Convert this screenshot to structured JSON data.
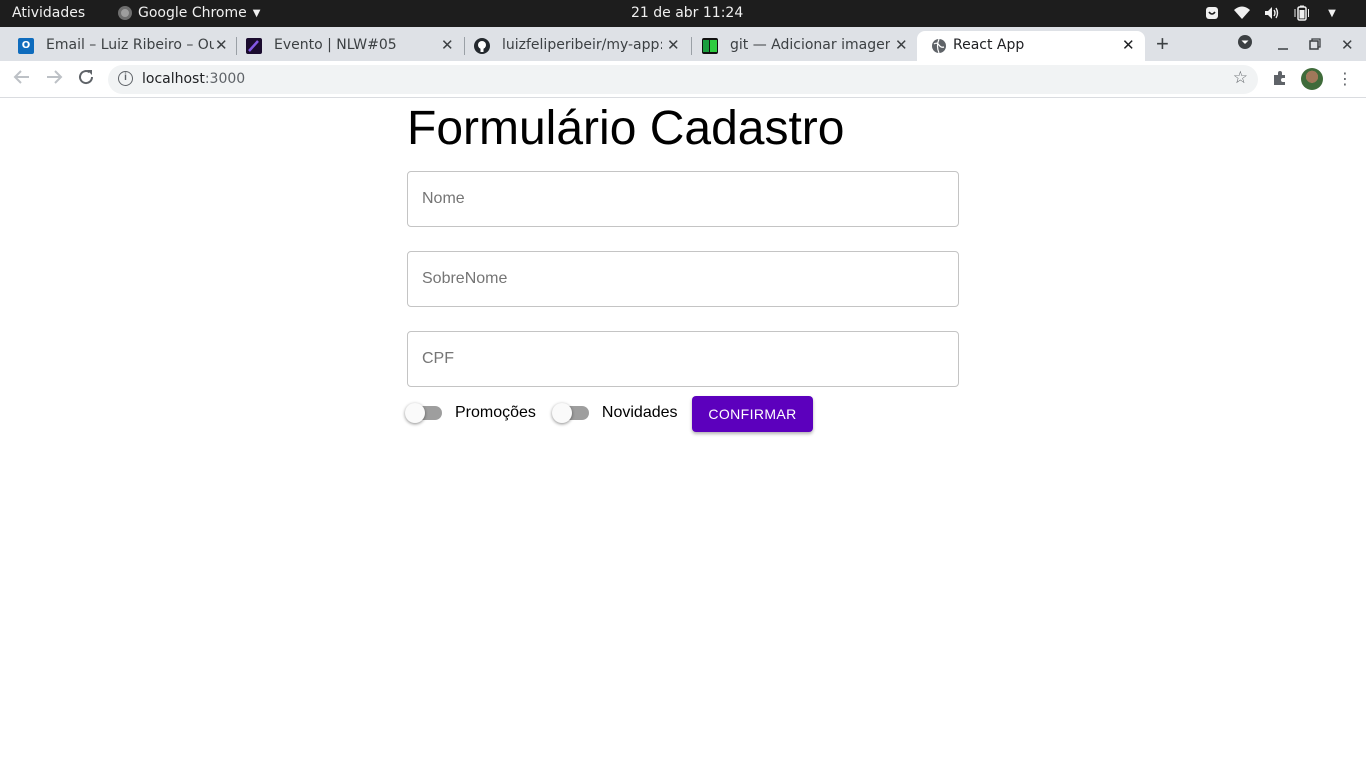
{
  "topbar": {
    "activities": "Atividades",
    "app_name": "Google Chrome",
    "clock": "21 de abr  11:24"
  },
  "tabs": [
    {
      "title": "Email – Luiz Ribeiro – Ou",
      "favicon": "outlook-icon",
      "color": "#0f6cbd"
    },
    {
      "title": "Evento | NLW#05",
      "favicon": "rocketseat-icon",
      "color": "#1a0b2e"
    },
    {
      "title": "luizfeliperibeir/my-app:",
      "favicon": "github-icon",
      "color": "#24292e"
    },
    {
      "title": "git — Adicionar imagens",
      "favicon": "stackoverflow-pt-icon",
      "color": "#1a6b2f"
    },
    {
      "title": "React App",
      "favicon": "globe-icon",
      "color": "#5f6368",
      "active": true
    }
  ],
  "address_bar": {
    "host": "localhost",
    "port": ":3000"
  },
  "form": {
    "title": "Formulário Cadastro",
    "fields": [
      {
        "placeholder": "Nome",
        "value": ""
      },
      {
        "placeholder": "SobreNome",
        "value": ""
      },
      {
        "placeholder": "CPF",
        "value": ""
      }
    ],
    "switches": [
      {
        "label": "Promoções",
        "checked": false
      },
      {
        "label": "Novidades",
        "checked": false
      }
    ],
    "submit_label": "CONFIRMAR"
  },
  "colors": {
    "accent": "#5c00bd",
    "switch_track": "#9e9e9e",
    "field_border": "#c4c4c4"
  }
}
